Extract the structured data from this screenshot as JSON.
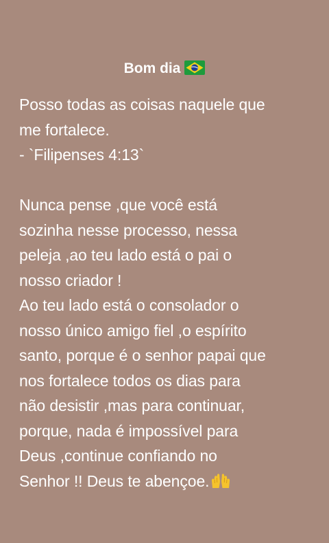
{
  "status": {
    "title": "Bom dia",
    "title_emoji": "brazil-flag-icon",
    "lines_part1": [
      "Posso todas as coisas naquele que",
      "me fortalece.",
      "- `Filipenses 4:13`"
    ],
    "lines_part2": [
      "Nunca pense ,que você está",
      "sozinha nesse processo, nessa",
      "peleja ,ao teu lado está o pai o",
      "nosso criador !",
      "Ao teu lado está o consolador o",
      "nosso único amigo fiel ,o espírito",
      "santo, porque é o senhor papai que",
      "nos fortalece todos os dias para",
      "não desistir ,mas para continuar,",
      "porque, nada é impossível para",
      "Deus ,continue confiando no"
    ],
    "last_line_start": "Senhor ",
    "last_line_excl": "!!",
    "last_line_end": "  Deus  te abençoe.",
    "last_line_emoji": "raising-hands-icon"
  },
  "colors": {
    "background": "#a88a7d",
    "text": "#ffffff"
  }
}
